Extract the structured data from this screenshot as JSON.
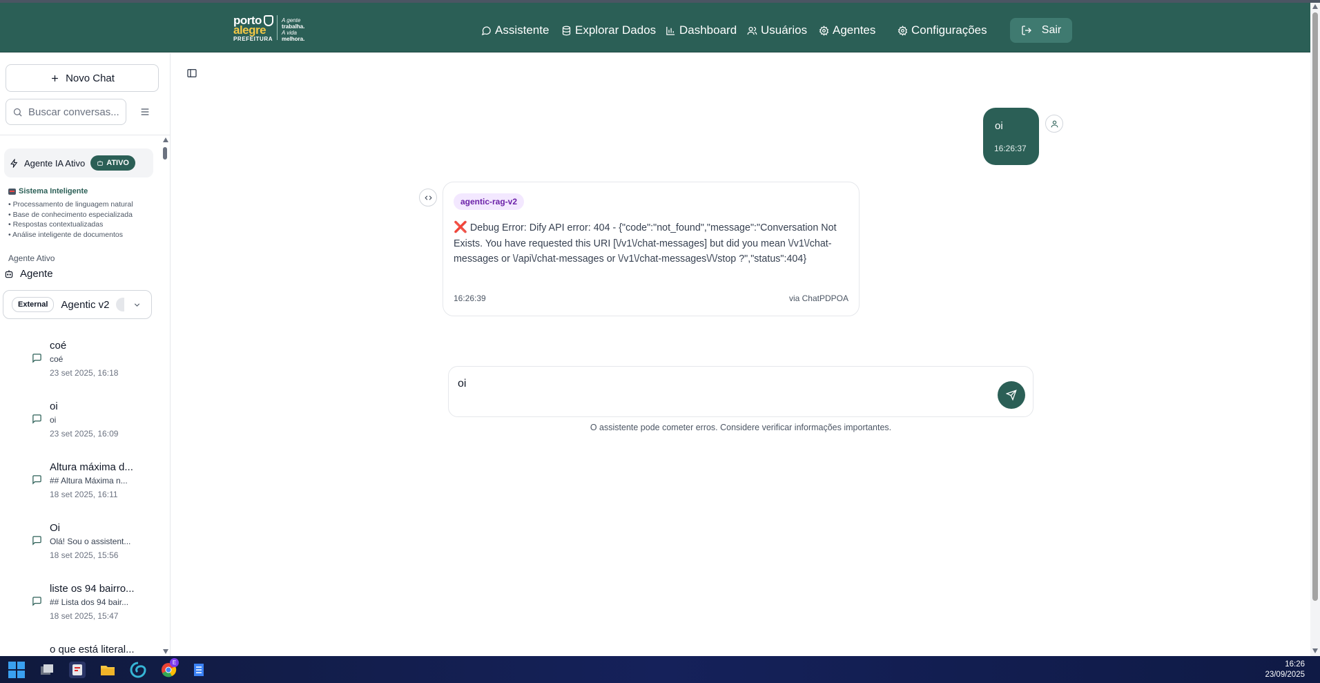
{
  "header": {
    "logo": {
      "line1": "porto",
      "line2": "alegre",
      "line3": "PREFEITURA",
      "tag1": "A gente",
      "tag2": "trabalha.",
      "tag3": "A vida",
      "tag4": "melhora."
    },
    "nav": [
      {
        "label": "Assistente",
        "icon": "chat-bubble-icon"
      },
      {
        "label": "Explorar Dados",
        "icon": "database-icon"
      },
      {
        "label": "Dashboard",
        "icon": "bar-chart-icon"
      },
      {
        "label": "Usuários",
        "icon": "users-icon"
      },
      {
        "label": "Agentes",
        "icon": "gear-icon"
      },
      {
        "label": "Configurações",
        "icon": "gear-icon"
      }
    ],
    "logout_label": "Sair"
  },
  "sidebar": {
    "new_chat_label": "Novo Chat",
    "search_placeholder": "Buscar conversas...",
    "agent_status": {
      "label": "Agente IA Ativo",
      "badge": "ATIVO"
    },
    "system": {
      "title": "Sistema Inteligente",
      "items": [
        "• Processamento de linguagem natural",
        "• Base de conhecimento especializada",
        "• Respostas contextualizadas",
        "• Análise inteligente de documentos"
      ]
    },
    "active_agent_label": "Agente Ativo",
    "agent_title": "Agente",
    "agent_select": {
      "badge": "External",
      "name": "Agentic v2"
    },
    "conversations": [
      {
        "title": "coé",
        "preview": "coé",
        "date": "23 set 2025, 16:18"
      },
      {
        "title": "oi",
        "preview": "oi",
        "date": "23 set 2025, 16:09"
      },
      {
        "title": "Altura máxima d...",
        "preview": "## Altura Máxima n...",
        "date": "18 set 2025, 16:11"
      },
      {
        "title": "Oi",
        "preview": "Olá! Sou o assistent...",
        "date": "18 set 2025, 15:56"
      },
      {
        "title": "liste os 94 bairro...",
        "preview": "## Lista dos 94 bair...",
        "date": "18 set 2025, 15:47"
      },
      {
        "title": "o que está literal...",
        "preview": "",
        "date": ""
      }
    ]
  },
  "chat": {
    "user_message": {
      "text": "oi",
      "time": "16:26:37"
    },
    "bot_message": {
      "agent_tag": "agentic-rag-v2",
      "error_icon": "❌",
      "text": "Debug Error: Dify API error: 404 - {\"code\":\"not_found\",\"message\":\"Conversation Not Exists. You have requested this URI [\\/v1\\/chat-messages] but did you mean \\/v1\\/chat-messages or \\/api\\/chat-messages or \\/v1\\/chat-messages\\/\\/stop ?\",\"status\":404}",
      "time": "16:26:39",
      "via": "via ChatPDPOA"
    },
    "input_value": "oi",
    "disclaimer": "O assistente pode cometer erros. Considere verificar informações importantes."
  },
  "taskbar": {
    "notification_badge": "E",
    "time": "16:26",
    "date": "23/09/2025"
  },
  "colors": {
    "brand": "#2b5f56",
    "brand_light": "#3f7a70",
    "tag_bg": "#f3e8ff",
    "tag_text": "#6b21a8",
    "error": "#dc2626"
  }
}
